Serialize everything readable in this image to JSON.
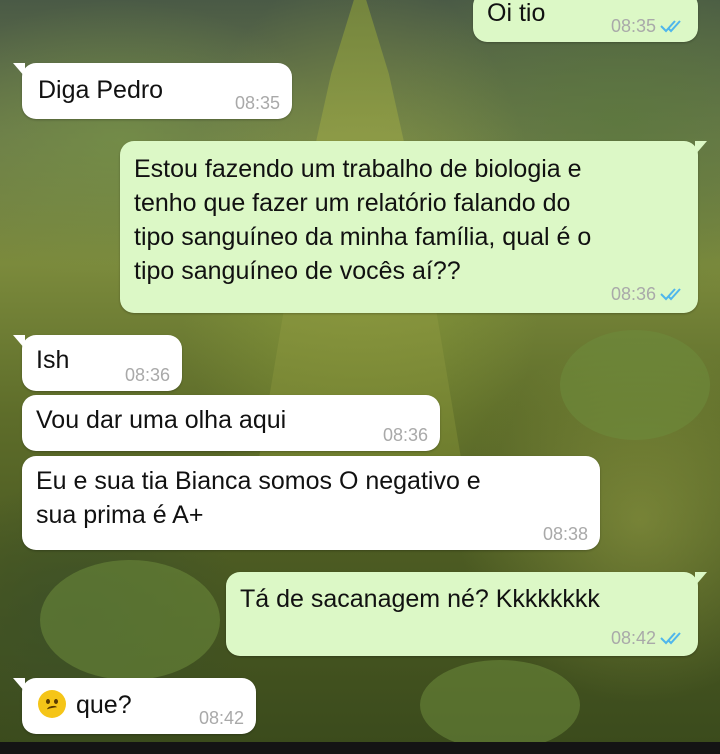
{
  "messages": [
    {
      "side": "out",
      "text": "Oi tio",
      "time": "08:35",
      "read": true
    },
    {
      "side": "in",
      "text": "Diga Pedro",
      "time": "08:35"
    },
    {
      "side": "out",
      "lines": [
        "Estou fazendo um trabalho de biologia e",
        "tenho que fazer um relatório falando do",
        "tipo sanguíneo da minha família, qual é o",
        "tipo sanguíneo de vocês aí??"
      ],
      "time": "08:36",
      "read": true
    },
    {
      "side": "in",
      "text": "Ish",
      "time": "08:36"
    },
    {
      "side": "in",
      "text": "Vou dar uma olha aqui",
      "time": "08:36"
    },
    {
      "side": "in",
      "lines": [
        "Eu e sua tia Bianca somos O negativo e",
        "sua prima é A+"
      ],
      "time": "08:38"
    },
    {
      "side": "out",
      "text": "Tá de sacanagem né? Kkkkkkkk",
      "time": "08:42",
      "read": true
    },
    {
      "side": "in",
      "text": "que?",
      "emoji": "confused-face",
      "time": "08:42"
    }
  ],
  "colors": {
    "incoming": "#ffffff",
    "outgoing": "#dcf8c6",
    "read_ticks": "#4fb6ec",
    "timestamp": "#a9a9a9"
  }
}
